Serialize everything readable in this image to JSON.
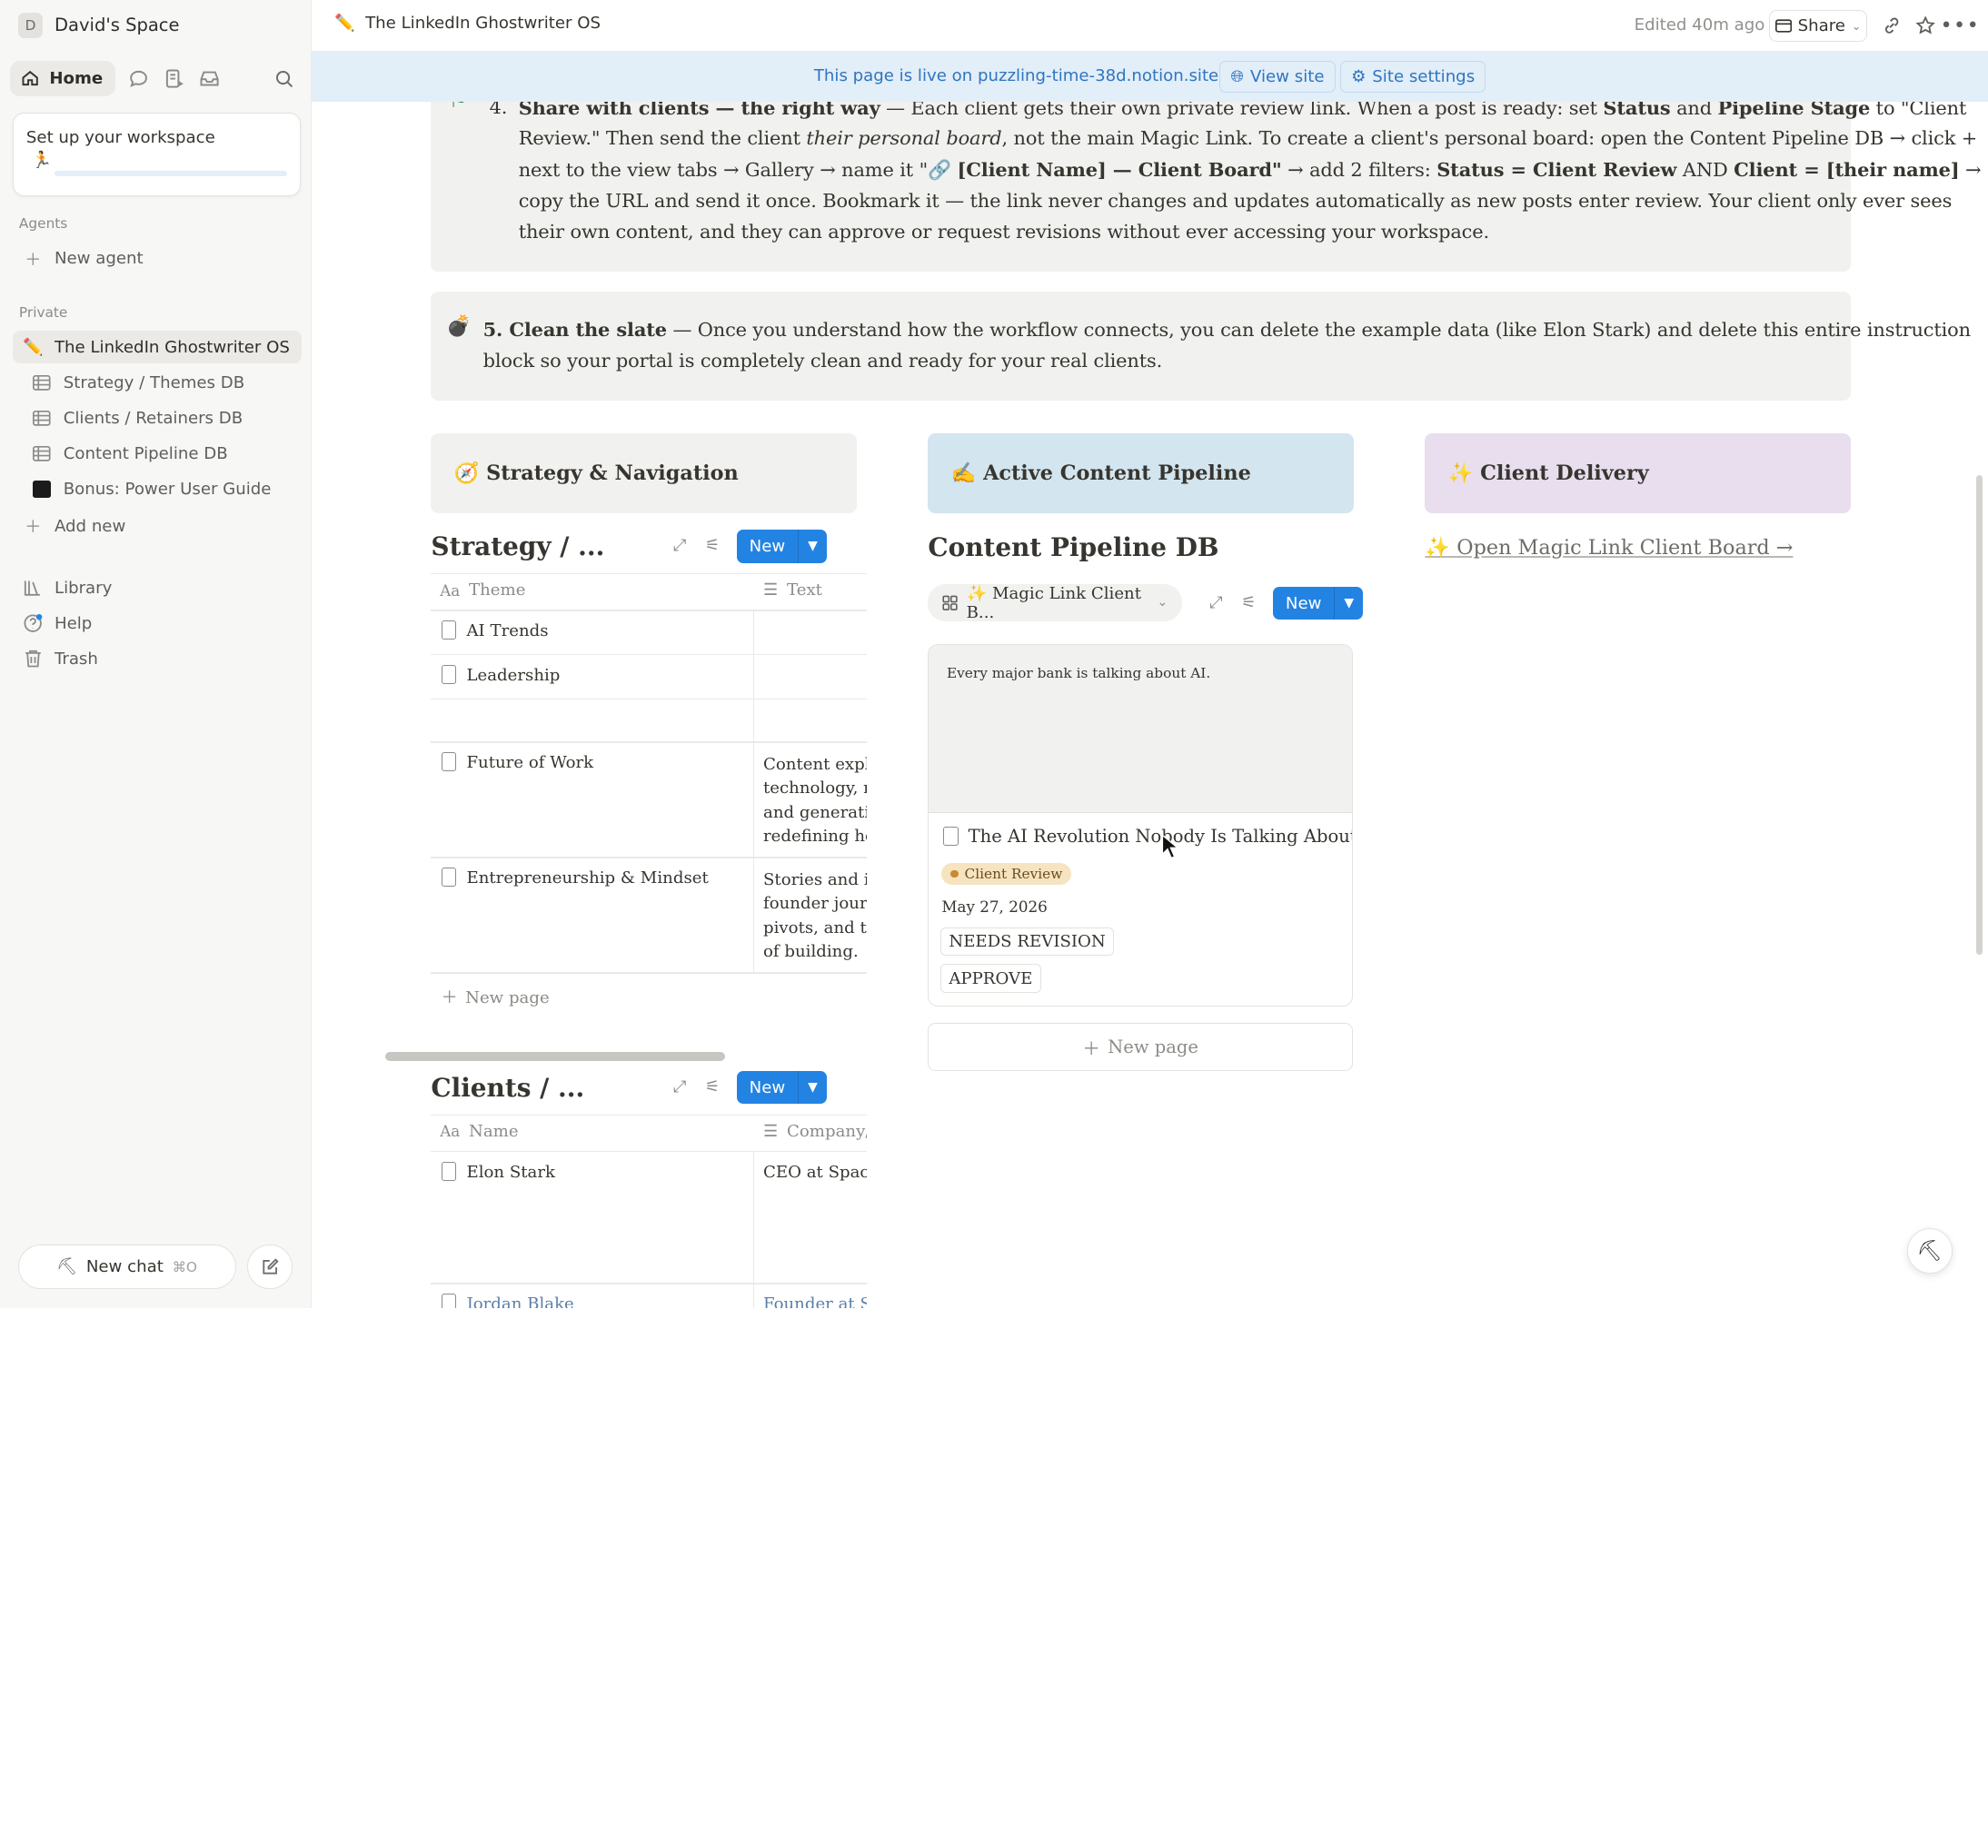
{
  "sidebar": {
    "workspace_initial": "D",
    "workspace_name": "David's Space",
    "home_label": "Home",
    "setup_title": "Set up your workspace",
    "agents_header": "Agents",
    "new_agent": "New agent",
    "private_header": "Private",
    "pages": [
      {
        "label": "The LinkedIn Ghostwriter OS",
        "icon": "pencil-icon"
      },
      {
        "label": "Strategy / Themes DB",
        "icon": "table-icon"
      },
      {
        "label": "Clients / Retainers DB",
        "icon": "table-icon"
      },
      {
        "label": "Content Pipeline DB",
        "icon": "table-icon"
      },
      {
        "label": "Bonus: Power User Guide",
        "icon": "black-square-icon"
      }
    ],
    "add_new": "Add new",
    "library": "Library",
    "help": "Help",
    "trash": "Trash",
    "new_chat": "New chat",
    "new_chat_shortcut": "⌘O"
  },
  "topbar": {
    "page_title": "The LinkedIn Ghostwriter OS",
    "edited": "Edited 40m ago",
    "share": "Share"
  },
  "banner": {
    "text": "This page is live on puzzling-time-38d.notion.site",
    "view_site": "View site",
    "site_settings": "Site settings"
  },
  "callout4": {
    "num": "4.",
    "l1_b1": "Share with clients — the right way",
    "l1_t1": " — Each client gets their own private review link. When a post is ready: set ",
    "l1_b2": "Status",
    "l1_t2": " and ",
    "l1_b3": "Pipeline Stage",
    "l1_t3": " to \"Client",
    "l2_t1": "Review.\" Then send the client ",
    "l2_i1": "their personal board",
    "l2_t2": ", not the main Magic Link. To create a client's personal board: open the Content Pipeline DB → click +",
    "l3_t1": "next to the view tabs → Gallery → name it \"🔗 ",
    "l3_b1": "[Client Name] — Client Board\"",
    "l3_t2": " → add 2 filters: ",
    "l3_b2": "Status = Client Review",
    "l3_t3": " AND ",
    "l3_b3": "Client = [their name]",
    "l3_t4": " →",
    "l4": "copy the URL and send it once. Bookmark it — the link never changes and updates automatically as new posts enter review. Your client only ever sees",
    "l5": "their own content, and they can approve or request revisions without ever accessing your workspace."
  },
  "callout5": {
    "b1": "5. Clean the slate",
    "l1_t1": " — Once you understand how the workflow connects, you can delete the example data (like Elon Stark) and delete this entire instruction",
    "l2": "block so your portal is completely clean and ready for your real clients."
  },
  "columns": {
    "strategy_head": "🧭 Strategy & Navigation",
    "pipeline_head": "✍️ Active Content Pipeline",
    "delivery_head": "✨ Client Delivery"
  },
  "strategy_db": {
    "title": "Strategy / ...",
    "new": "New",
    "col1": "Theme",
    "col2": "Text",
    "rows": [
      {
        "name": "AI Trends",
        "text": []
      },
      {
        "name": "Leadership",
        "text": []
      },
      {
        "name": "",
        "text": []
      },
      {
        "name": "Future of Work",
        "text": [
          "Content explor",
          "technology, re",
          "and generation",
          "redefining how"
        ]
      },
      {
        "name": "Entrepreneurship & Mindset",
        "text": [
          "Stories and ins",
          "founder journe",
          "pivots, and the",
          "of building."
        ]
      }
    ],
    "new_page": "New page"
  },
  "pipeline_db": {
    "title": "Content Pipeline DB",
    "view_tab": "✨ Magic Link Client B...",
    "new": "New",
    "card_preview": "Every major bank is talking about AI.",
    "card_title": "The AI Revolution Nobody Is Talking About",
    "card_status": "Client Review",
    "card_date": "May 27, 2026",
    "btn_revision": "NEEDS REVISION",
    "btn_approve": "APPROVE",
    "new_page": "New page"
  },
  "delivery": {
    "link": "✨ Open Magic Link Client Board →"
  },
  "clients_db": {
    "title": "Clients / ...",
    "new": "New",
    "col1": "Name",
    "col2": "Company/",
    "rows": [
      {
        "name": "Elon Stark",
        "company": "CEO at SpaceX"
      },
      {
        "name": "Jordan Blake",
        "company": "Founder at Sp"
      }
    ]
  },
  "colors": {
    "accent": "#2383e2",
    "banner_bg": "#e2eef8",
    "pipeline_head_bg": "#d3e5ef",
    "delivery_head_bg": "#e8deee",
    "callout_bg": "#f1f1ef",
    "status_bg": "#f6e3c0"
  }
}
